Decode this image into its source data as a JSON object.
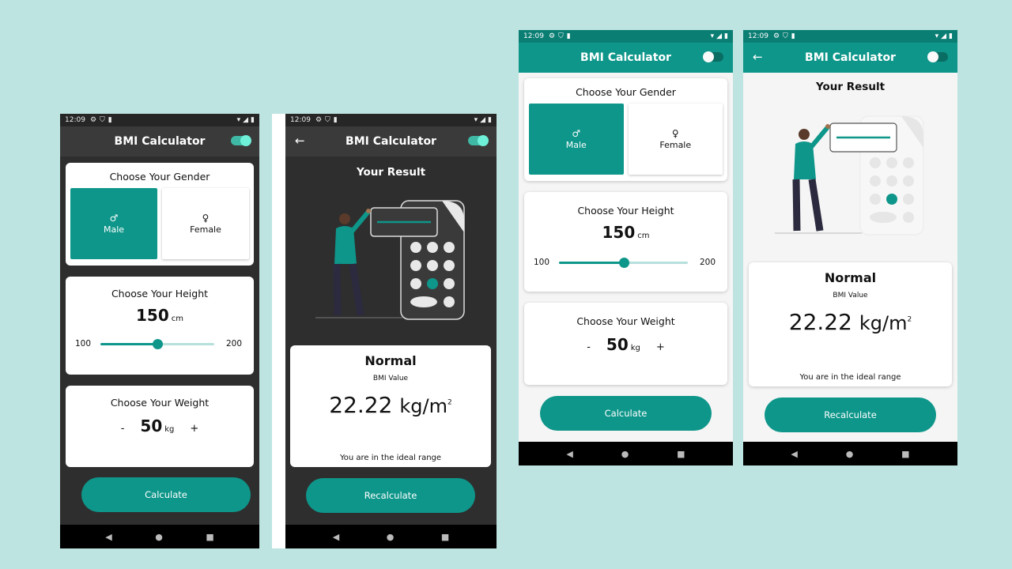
{
  "colors": {
    "background": "#bde4e0",
    "accent": "#0e968a",
    "dark_bg": "#2e2e2e",
    "dark_appbar": "#3a3a3a",
    "light_bg": "#f5f5f5"
  },
  "status_bar": {
    "time": "12:09"
  },
  "app_bar": {
    "title": "BMI Calculator"
  },
  "gender": {
    "title": "Choose Your Gender",
    "male_symbol": "♂",
    "male_label": "Male",
    "female_symbol": "♀",
    "female_label": "Female",
    "selected": "Male"
  },
  "height": {
    "title": "Choose Your Height",
    "value": "150",
    "unit": "cm",
    "min": "100",
    "max": "200",
    "fraction": 0.5
  },
  "weight": {
    "title": "Choose Your Weight",
    "minus": "-",
    "value": "50",
    "unit": "kg",
    "plus": "+"
  },
  "calculate_label": "Calculate",
  "result": {
    "title": "Your Result",
    "status": "Normal",
    "label": "BMI Value",
    "value": "22.22",
    "unit": "kg/m",
    "unit_sup": "2",
    "message": "You are in the ideal range",
    "recalculate_label": "Recalculate"
  },
  "nav": {
    "back_icon": "◀",
    "home_icon": "●",
    "recents_icon": "■"
  },
  "icons": {
    "back_arrow": "←",
    "status_left": [
      "gear-icon",
      "shield-icon",
      "sd-card-icon"
    ],
    "status_right": [
      "wifi-icon",
      "signal-icon",
      "battery-icon"
    ]
  }
}
